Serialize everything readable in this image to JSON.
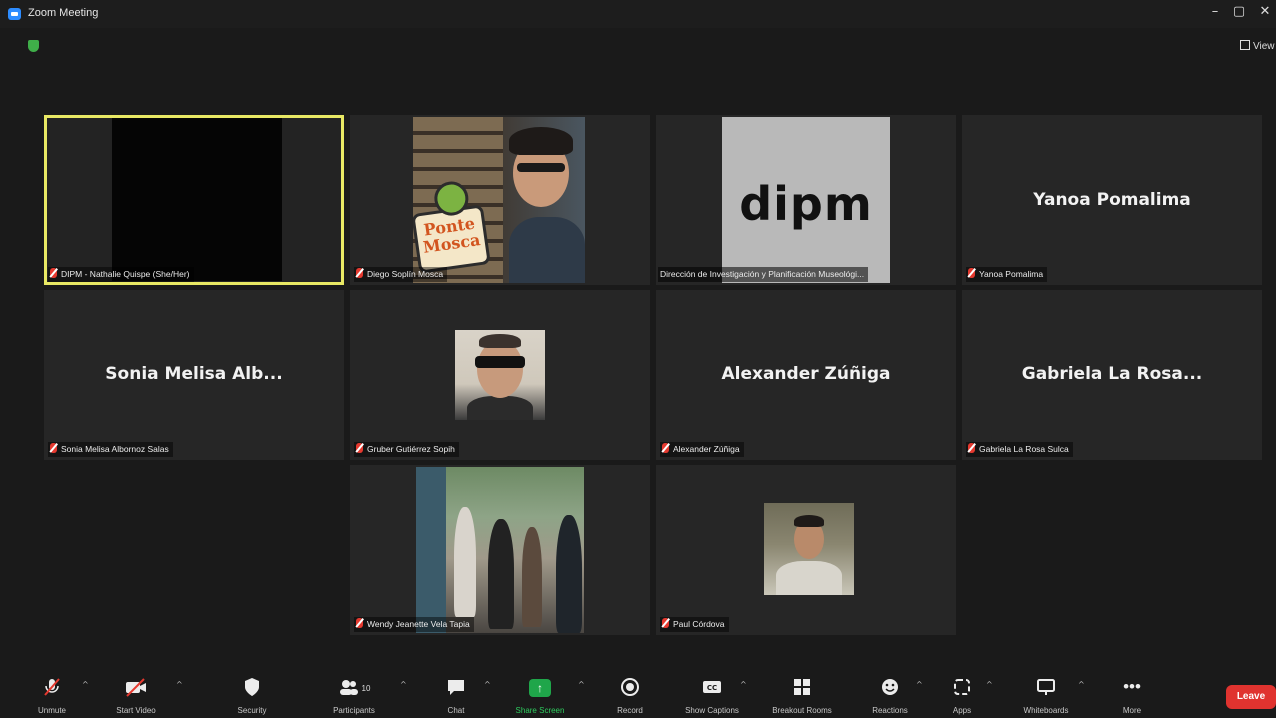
{
  "window": {
    "title": "Zoom Meeting",
    "controls": [
      "–",
      "▢",
      "✕"
    ]
  },
  "view_button": {
    "label": "View"
  },
  "participants": [
    {
      "label": "DIPM - Nathalie Quispe (She/Her)",
      "active": true
    },
    {
      "label": "Diego Soplín Mosca"
    },
    {
      "label": "Dirección de Investigación y Planificación Museológi...",
      "logo_text": "dipm"
    },
    {
      "label": "Yanoa Pomalima",
      "display_name": "Yanoa Pomalima"
    },
    {
      "label": "Sonia Melisa Albornoz Salas",
      "display_name": "Sonia Melisa Alb..."
    },
    {
      "label": "Gruber Gutiérrez Sopih"
    },
    {
      "label": "Alexander Zúñiga",
      "display_name": "Alexander Zúñiga"
    },
    {
      "label": "Gabriela La Rosa Sulca",
      "display_name": "Gabriela La Rosa..."
    },
    {
      "label": "Wendy Jeanette Vela Tapia"
    },
    {
      "label": "Paul Córdova"
    }
  ],
  "sticker_text": [
    "Ponte",
    "Mosca"
  ],
  "toolbar": {
    "unmute": "Unmute",
    "start_video": "Start Video",
    "security": "Security",
    "participants": "Participants",
    "participants_count": "10",
    "chat": "Chat",
    "share_screen": "Share Screen",
    "record": "Record",
    "show_captions": "Show Captions",
    "breakout_rooms": "Breakout Rooms",
    "reactions": "Reactions",
    "apps": "Apps",
    "whiteboards": "Whiteboards",
    "more": "More",
    "leave": "Leave"
  },
  "colors": {
    "active_speaker": "#e8e864",
    "share_green": "#1fa64a",
    "leave_red": "#e0332f",
    "muted_red": "#e5392f"
  }
}
